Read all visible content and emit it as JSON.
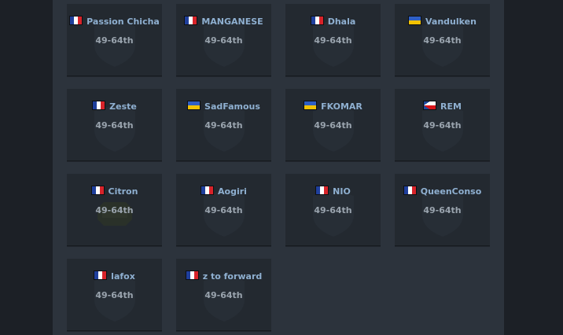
{
  "teams": [
    {
      "name": "Passion Chicha",
      "flag": "france-flag",
      "placement": "49-64th",
      "logo": "shield-icon"
    },
    {
      "name": "MANGANESE",
      "flag": "france-flag",
      "placement": "49-64th",
      "logo": "shield-icon"
    },
    {
      "name": "Dhala",
      "flag": "france-flag",
      "placement": "49-64th",
      "logo": "shield-icon"
    },
    {
      "name": "Vandulken",
      "flag": "ukraine-flag",
      "placement": "49-64th",
      "logo": "shield-icon"
    },
    {
      "name": "Zeste",
      "flag": "france-flag",
      "placement": "49-64th",
      "logo": "shield-icon"
    },
    {
      "name": "SadFamous",
      "flag": "ukraine-flag",
      "placement": "49-64th",
      "logo": "shield-icon"
    },
    {
      "name": "FKOMAR",
      "flag": "ukraine-flag",
      "placement": "49-64th",
      "logo": "shield-icon"
    },
    {
      "name": "REM",
      "flag": "czech-flag",
      "placement": "49-64th",
      "logo": "shield-icon"
    },
    {
      "name": "Citron",
      "flag": "france-flag",
      "placement": "49-64th",
      "logo": "badge-icon"
    },
    {
      "name": "Aogiri",
      "flag": "france-flag",
      "placement": "49-64th",
      "logo": "shield-icon"
    },
    {
      "name": "NIO",
      "flag": "france-flag",
      "placement": "49-64th",
      "logo": "shield-icon"
    },
    {
      "name": "QueenConso",
      "flag": "france-flag",
      "placement": "49-64th",
      "logo": "shield-icon"
    },
    {
      "name": "lafox",
      "flag": "france-flag",
      "placement": "49-64th",
      "logo": "shield-icon"
    },
    {
      "name": "z to forward",
      "flag": "france-flag",
      "placement": "49-64th",
      "logo": "shield-icon"
    }
  ],
  "colors": {
    "page_bg": "#1c2026",
    "panel_bg": "#2c333c",
    "card_bg": "#232930",
    "team_name": "#8fb0d1",
    "placement_text": "#9aa4ae"
  }
}
